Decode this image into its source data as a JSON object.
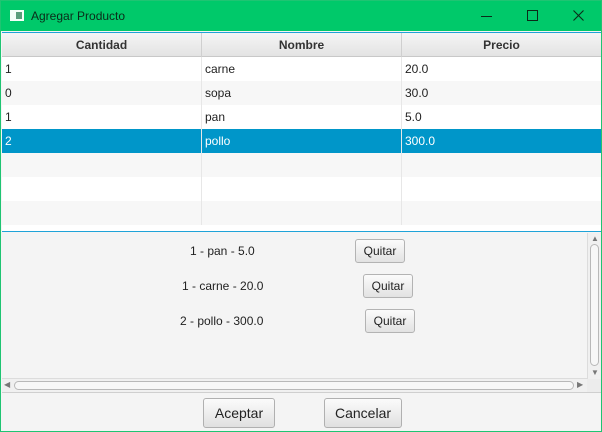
{
  "window": {
    "title": "Agregar Producto",
    "accent_color": "#00c96a",
    "controls": [
      "minimize-icon",
      "maximize-icon",
      "close-icon"
    ]
  },
  "table": {
    "columns": [
      "Cantidad",
      "Nombre",
      "Precio"
    ],
    "rows": [
      {
        "cantidad": "1",
        "nombre": "carne",
        "precio": "20.0"
      },
      {
        "cantidad": "0",
        "nombre": "sopa",
        "precio": "30.0"
      },
      {
        "cantidad": "1",
        "nombre": "pan",
        "precio": "5.0"
      },
      {
        "cantidad": "2",
        "nombre": "pollo",
        "precio": "300.0"
      }
    ],
    "selected_row": 3,
    "selection_color": "#0096c9"
  },
  "items": [
    {
      "label": "1 - pan - 5.0",
      "button": "Quitar"
    },
    {
      "label": "1 - carne - 20.0",
      "button": "Quitar"
    },
    {
      "label": "2 - pollo - 300.0",
      "button": "Quitar"
    }
  ],
  "footer": {
    "accept_label": "Aceptar",
    "cancel_label": "Cancelar"
  }
}
